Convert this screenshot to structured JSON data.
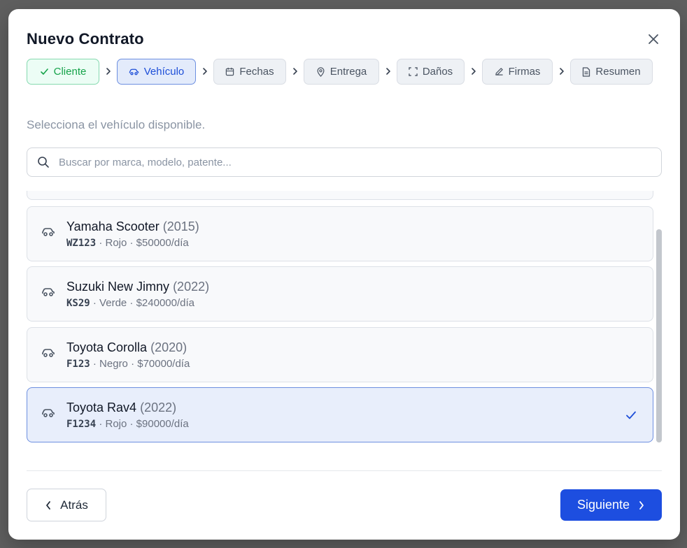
{
  "modal": {
    "title": "Nuevo Contrato"
  },
  "steps": [
    {
      "label": "Cliente",
      "state": "done",
      "icon": "check-icon"
    },
    {
      "label": "Vehículo",
      "state": "active",
      "icon": "car-icon"
    },
    {
      "label": "Fechas",
      "state": "pending",
      "icon": "calendar-icon"
    },
    {
      "label": "Entrega",
      "state": "pending",
      "icon": "map-pin-icon"
    },
    {
      "label": "Daños",
      "state": "pending",
      "icon": "scan-icon"
    },
    {
      "label": "Firmas",
      "state": "pending",
      "icon": "pen-icon"
    },
    {
      "label": "Resumen",
      "state": "pending",
      "icon": "file-icon"
    }
  ],
  "hint": "Selecciona el vehículo disponible.",
  "search": {
    "placeholder": "Buscar por marca, modelo, patente...",
    "value": ""
  },
  "vehicles": [
    {
      "name": "Yamaha Scooter",
      "year": "(2015)",
      "plate": "WZ123",
      "details": " · Rojo · $50000/día",
      "selected": false
    },
    {
      "name": "Suzuki New Jimny",
      "year": "(2022)",
      "plate": "KS29",
      "details": " · Verde · $240000/día",
      "selected": false
    },
    {
      "name": "Toyota Corolla",
      "year": "(2020)",
      "plate": "F123",
      "details": " · Negro · $70000/día",
      "selected": false
    },
    {
      "name": "Toyota Rav4",
      "year": "(2022)",
      "plate": "F1234",
      "details": " · Rojo · $90000/día",
      "selected": true
    }
  ],
  "footer": {
    "back_label": "Atrás",
    "next_label": "Siguiente"
  },
  "colors": {
    "primary": "#1d4ee0",
    "success": "#16a34a",
    "selected_bg": "#e8eefb"
  }
}
